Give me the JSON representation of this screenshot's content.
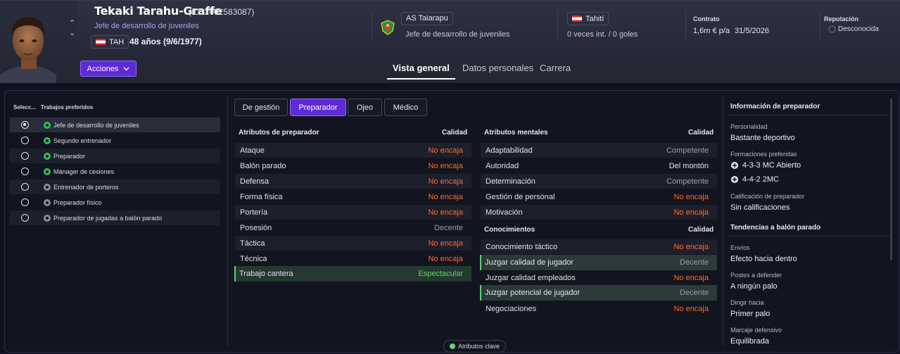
{
  "person": {
    "name": "Tekaki Tarahu-Graffe",
    "id_text": "(ID: 2002583087)",
    "job": "Jefe de desarrollo de juveniles",
    "nation_code": "TAH",
    "age_text": "48 años (9/6/1977)"
  },
  "club": {
    "name": "AS Taiarapu",
    "role": "Jefe de desarrollo de juveniles"
  },
  "nationality": {
    "name": "Tahití",
    "caps": "0 veces int. / 0 goles"
  },
  "contract": {
    "label": "Contrato",
    "salary": "1,6m € p/a",
    "expiry": "31/5/2026"
  },
  "reputation": {
    "label": "Reputación",
    "value": "Desconocida"
  },
  "actions_label": "Acciones",
  "main_tabs": [
    {
      "label": "Vista general",
      "active": true
    },
    {
      "label": "Datos personales",
      "active": false
    },
    {
      "label": "Carrera",
      "active": false
    }
  ],
  "left_panel": {
    "col_select": "Selecc...",
    "col_jobs": "Trabajos preferidos",
    "jobs": [
      {
        "label": "Jefe de desarrollo de juveniles",
        "selected": true,
        "icon": "green-whistle-icon"
      },
      {
        "label": "Segundo entrenador",
        "selected": false,
        "icon": "green-whistle-icon"
      },
      {
        "label": "Preparador",
        "selected": false,
        "icon": "green-whistle-icon"
      },
      {
        "label": "Mánager de cesiones",
        "selected": false,
        "icon": "green-whistle-icon"
      },
      {
        "label": "Entrenador de porteros",
        "selected": false,
        "icon": "grey-whistle-icon"
      },
      {
        "label": "Preparador físico",
        "selected": false,
        "icon": "grey-whistle-icon"
      },
      {
        "label": "Preparador de jugadas a balón parado",
        "selected": false,
        "icon": "grey-whistle-icon"
      }
    ]
  },
  "sub_tabs": [
    {
      "label": "De gestión",
      "active": false
    },
    {
      "label": "Preparador",
      "active": true
    },
    {
      "label": "Ojeo",
      "active": false
    },
    {
      "label": "Médico",
      "active": false
    }
  ],
  "coach_attrs": {
    "title": "Atributos de preparador",
    "quality_header": "Calidad",
    "rows": [
      {
        "name": "Ataque",
        "value": "No encaja",
        "tone": "no"
      },
      {
        "name": "Balón parado",
        "value": "No encaja",
        "tone": "no"
      },
      {
        "name": "Defensa",
        "value": "No encaja",
        "tone": "no"
      },
      {
        "name": "Forma física",
        "value": "No encaja",
        "tone": "no"
      },
      {
        "name": "Portería",
        "value": "No encaja",
        "tone": "no"
      },
      {
        "name": "Posesión",
        "value": "Decente",
        "tone": "grey"
      },
      {
        "name": "Táctica",
        "value": "No encaja",
        "tone": "no"
      },
      {
        "name": "Técnica",
        "value": "No encaja",
        "tone": "no"
      },
      {
        "name": "Trabajo cantera",
        "value": "Espectacular",
        "tone": "green"
      }
    ]
  },
  "mental_attrs": {
    "title": "Atributos mentales",
    "quality_header": "Calidad",
    "rows": [
      {
        "name": "Adaptabilidad",
        "value": "Competente",
        "tone": "grey"
      },
      {
        "name": "Autoridad",
        "value": "Del montón",
        "tone": "white"
      },
      {
        "name": "Determinación",
        "value": "Competente",
        "tone": "grey"
      },
      {
        "name": "Gestión de personal",
        "value": "No encaja",
        "tone": "no"
      },
      {
        "name": "Motivación",
        "value": "No encaja",
        "tone": "no"
      }
    ]
  },
  "knowledge": {
    "title": "Conocimientos",
    "quality_header": "Calidad",
    "rows": [
      {
        "name": "Conocimiento táctico",
        "value": "No encaja",
        "tone": "no"
      },
      {
        "name": "Juzgar calidad de jugador",
        "value": "Decente",
        "tone": "grey"
      },
      {
        "name": "Juzgar calidad empleados",
        "value": "No encaja",
        "tone": "no"
      },
      {
        "name": "Juzgar potencial de jugador",
        "value": "Decente",
        "tone": "grey"
      },
      {
        "name": "Negociaciones",
        "value": "No encaja",
        "tone": "no"
      }
    ]
  },
  "coach_info": {
    "title": "Información de preparador",
    "personality_label": "Personalidad",
    "personality": "Bastante deportivo",
    "formations_label": "Formaciones preferidas",
    "formations": [
      "4-3-3 MC Abierto",
      "4-4-2 2MC"
    ],
    "rating_label": "Calificación de preparador",
    "rating": "Sin calificaciones",
    "setpiece_title": "Tendencias a balón parado",
    "delivery_label": "Envíos",
    "delivery": "Efecto hacia dentro",
    "posts_label": "Postes a defender",
    "posts": "A ningún palo",
    "direct_label": "Dirigir hacia",
    "direct": "Primer palo",
    "marking_label": "Marcaje defensivo",
    "marking": "Equilibrada"
  },
  "key_attrs_label": "Atributos clave",
  "colors": {
    "accent": "#5f2bd6",
    "no_fit": "#ff6a2a",
    "spectacular": "#66d36f"
  }
}
